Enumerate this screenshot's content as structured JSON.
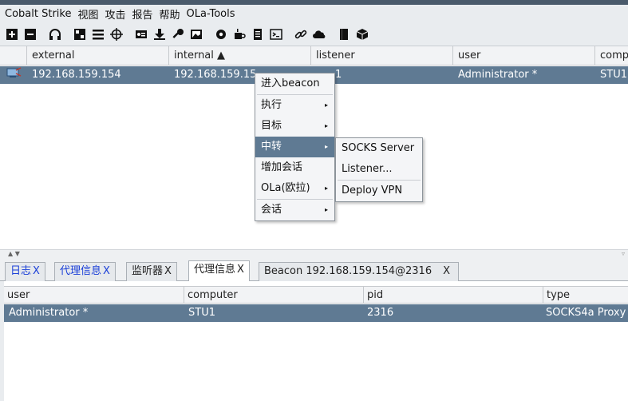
{
  "menubar": {
    "items": [
      "Cobalt Strike",
      "视图",
      "攻击",
      "报告",
      "帮助",
      "OLa-Tools"
    ]
  },
  "toolbar": {
    "icons": [
      "new-connection-icon",
      "disconnect-icon",
      "headphones-icon",
      "pivot-graph-icon",
      "session-table-icon",
      "targets-icon",
      "credentials-icon",
      "downloads-icon",
      "keystrokes-icon",
      "screenshots-icon",
      "settings-icon",
      "coffee-icon",
      "script-icon",
      "console-icon",
      "link-icon",
      "cloud-icon",
      "book-icon",
      "package-icon"
    ]
  },
  "top_table": {
    "columns": [
      "external",
      "internal ▲",
      "listener",
      "user",
      "comp"
    ],
    "row": {
      "external": "192.168.159.154",
      "internal": "192.168.159.15",
      "listener": "1",
      "user": "Administrator *",
      "computer": "STU1"
    }
  },
  "context_menu": {
    "items": [
      "进入beacon",
      "执行",
      "目标",
      "中转",
      "增加会话",
      "OLa(欧拉)",
      "会话"
    ],
    "highlighted": "中转"
  },
  "submenu": {
    "items": [
      "SOCKS Server",
      "Listener...",
      "Deploy VPN"
    ]
  },
  "tabs": [
    {
      "label": "日志",
      "close": "X"
    },
    {
      "label": "代理信息",
      "close": "X"
    },
    {
      "label": "监听器",
      "close": "X"
    },
    {
      "label": "代理信息",
      "close": "X"
    },
    {
      "label": "Beacon 192.168.159.154@2316",
      "close": "X"
    }
  ],
  "bottom_table": {
    "columns": [
      "user",
      "computer",
      "pid",
      "type"
    ],
    "row": {
      "user": "Administrator *",
      "computer": "STU1",
      "pid": "2316",
      "type": "SOCKS4a Proxy"
    }
  },
  "colors": {
    "selection": "#5f7a93",
    "link_tab": "#1a3fd8"
  }
}
